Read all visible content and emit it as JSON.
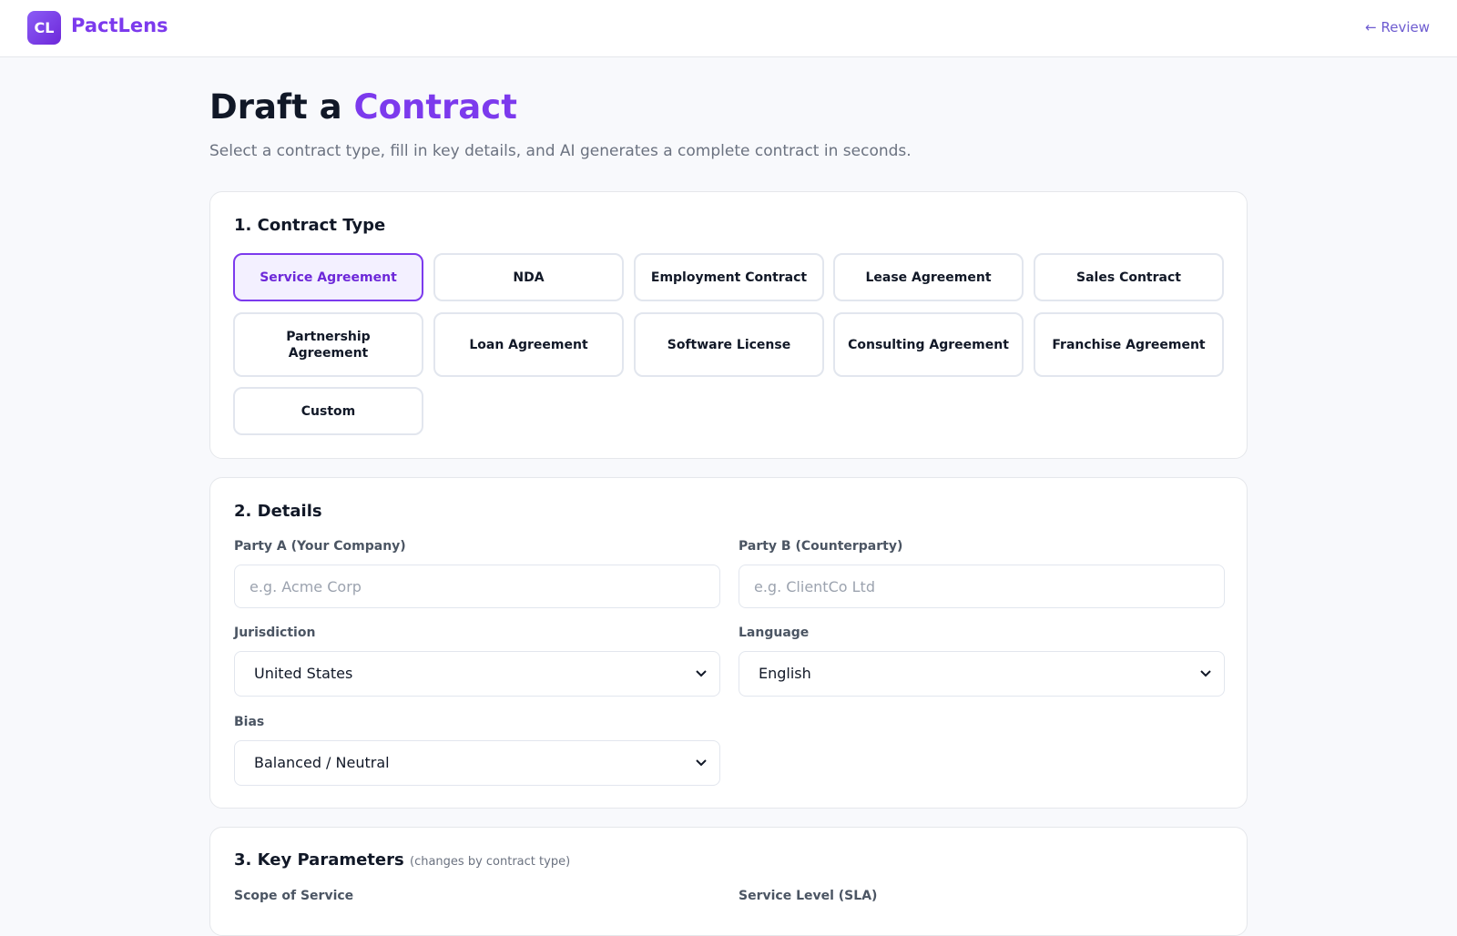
{
  "header": {
    "logo_text": "CL",
    "brand": "PactLens",
    "back_link": "← Review"
  },
  "page": {
    "title_prefix": "Draft a",
    "title_accent": "Contract",
    "subtitle": "Select a contract type, fill in key details, and AI generates a complete contract in seconds."
  },
  "section1": {
    "title": "1. Contract Type",
    "selected": "Service Agreement",
    "types": [
      "Service Agreement",
      "NDA",
      "Employment Contract",
      "Lease Agreement",
      "Sales Contract",
      "Partnership Agreement",
      "Loan Agreement",
      "Software License",
      "Consulting Agreement",
      "Franchise Agreement",
      "Custom"
    ]
  },
  "section2": {
    "title": "2. Details",
    "party_a": {
      "label": "Party A (Your Company)",
      "placeholder": "e.g. Acme Corp",
      "value": ""
    },
    "party_b": {
      "label": "Party B (Counterparty)",
      "placeholder": "e.g. ClientCo Ltd",
      "value": ""
    },
    "jurisdiction": {
      "label": "Jurisdiction",
      "value": "United States"
    },
    "language": {
      "label": "Language",
      "value": "English"
    },
    "bias": {
      "label": "Bias",
      "value": "Balanced / Neutral"
    }
  },
  "section3": {
    "title": "3. Key Parameters",
    "hint": "(changes by contract type)",
    "scope_label": "Scope of Service",
    "sla_label": "Service Level (SLA)"
  },
  "colors": {
    "accent": "#7c3aed",
    "selected_bg": "#f3f0ff",
    "border": "#e2e6ee"
  }
}
